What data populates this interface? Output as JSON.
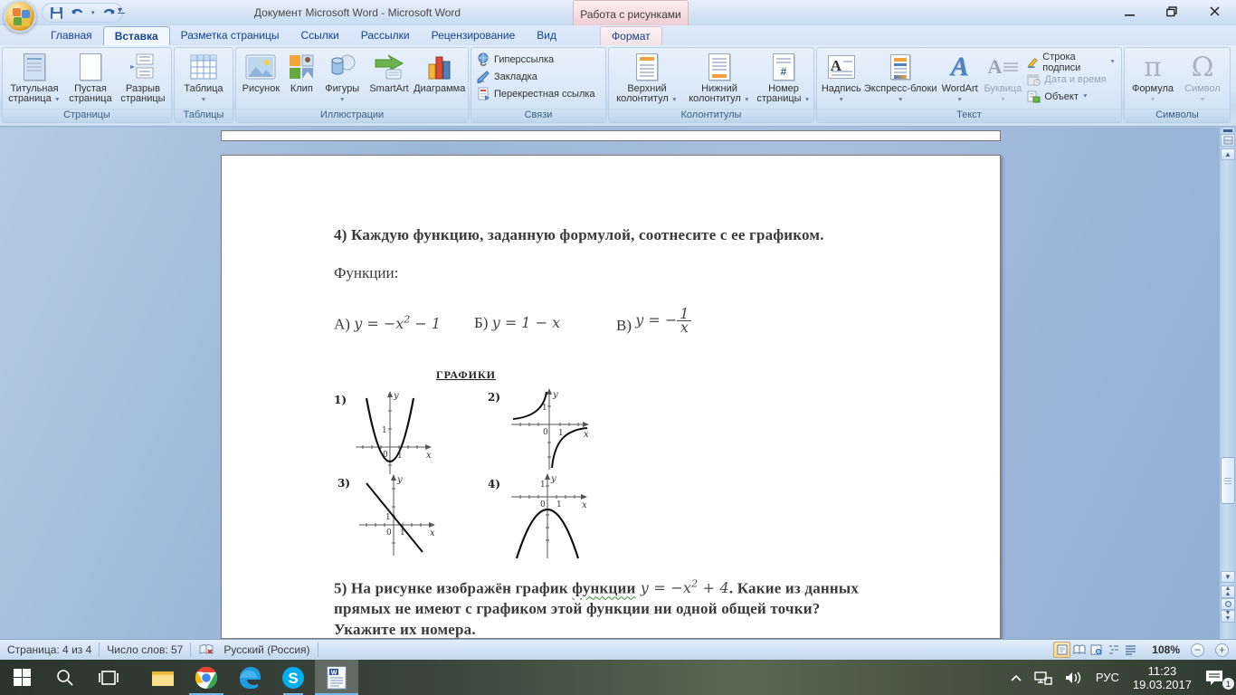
{
  "window": {
    "title": "Документ Microsoft Word - Microsoft Word",
    "context_group_label": "Работа с рисунками"
  },
  "tabs": {
    "home": "Главная",
    "insert": "Вставка",
    "page_layout": "Разметка страницы",
    "references": "Ссылки",
    "mailings": "Рассылки",
    "review": "Рецензирование",
    "view": "Вид",
    "format": "Формат"
  },
  "ribbon": {
    "pages": {
      "label": "Страницы",
      "title_page": "Титульная страница",
      "blank_page": "Пустая страница",
      "page_break": "Разрыв страницы"
    },
    "tables": {
      "label": "Таблицы",
      "table": "Таблица"
    },
    "illustrations": {
      "label": "Иллюстрации",
      "picture": "Рисунок",
      "clipart": "Клип",
      "shapes": "Фигуры",
      "smartart": "SmartArt",
      "chart": "Диаграмма"
    },
    "links": {
      "label": "Связи",
      "hyperlink": "Гиперссылка",
      "bookmark": "Закладка",
      "crossref": "Перекрестная ссылка"
    },
    "header_footer": {
      "label": "Колонтитулы",
      "header": "Верхний колонтитул",
      "footer": "Нижний колонтитул",
      "page_number": "Номер страницы"
    },
    "text": {
      "label": "Текст",
      "textbox": "Надпись",
      "quickparts": "Экспресс-блоки",
      "wordart": "WordArt",
      "dropcap": "Буквица",
      "signature": "Строка подписи",
      "datetime": "Дата и время",
      "object": "Объект"
    },
    "symbols": {
      "label": "Символы",
      "equation": "Формула",
      "symbol": "Символ",
      "equation_glyph": "π",
      "symbol_glyph": "Ω"
    },
    "icon_letters": {
      "textbox": "А",
      "wordart": "А",
      "dropcap": "А",
      "page_number": "#"
    }
  },
  "document": {
    "q4_heading": "4) Каждую функцию, заданную формулой, соотнесите с ее графиком.",
    "functions_label": "Функции:",
    "func_a": {
      "label": "А)",
      "pre": "y = −x",
      "sup": "2",
      "post": " − 1"
    },
    "func_b": {
      "label": "Б)",
      "formula": "y = 1 − x"
    },
    "func_c": {
      "label": "В)",
      "pre": "y = −",
      "num": "1",
      "den": "x"
    },
    "graphs_title": "ГРАФИКИ",
    "axis": {
      "x": "x",
      "y": "y",
      "zero": "0",
      "one": "1"
    },
    "graphs": [
      {
        "label": "1)",
        "shape": "upward parabola, vertex (0,-1), y = x^2 - 1"
      },
      {
        "label": "2)",
        "shape": "hyperbola branches in 2nd and 4th quadrants, y = -1/x"
      },
      {
        "label": "3)",
        "shape": "descending line through (0,1) and (1,0), y = 1 - x"
      },
      {
        "label": "4)",
        "shape": "downward parabola, vertex (0,-1), y = -x^2 - 1"
      }
    ],
    "q5_part1": "5) На рисунке изображён график ",
    "q5_word_squiggle": "функции",
    "q5_formula": {
      "pre": " y = −x",
      "sup": "2",
      "post": " + 4"
    },
    "q5_part2": ". Какие из данных",
    "q5_line2": "прямых не имеют с графиком этой функции ни одной общей точки?",
    "q5_line3": "Укажите их номера."
  },
  "status_bar": {
    "page": "Страница: 4 из 4",
    "words": "Число слов: 57",
    "language": "Русский (Россия)",
    "zoom": "108%"
  },
  "taskbar": {
    "lang": "РУС",
    "time": "11:23",
    "date": "19.03.2017",
    "notification_badge": "1"
  },
  "colors": {
    "active_view_btn": "#f9d389",
    "context_tab": "#f3d8dd",
    "taskbar_indicator": "#76b9ed",
    "accent_blue": "#15428b"
  }
}
